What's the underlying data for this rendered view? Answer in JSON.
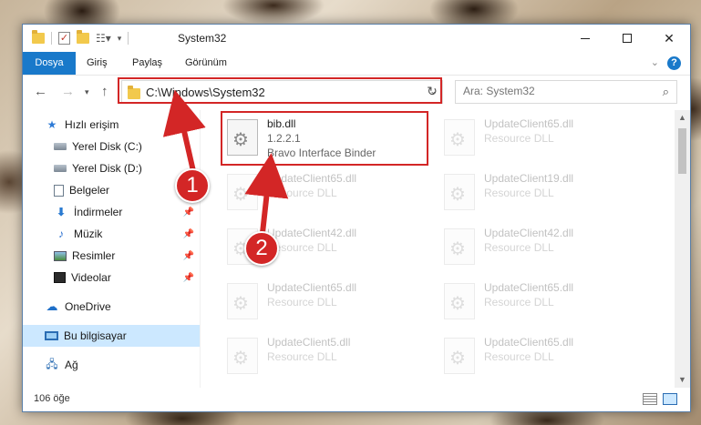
{
  "window": {
    "title": "System32",
    "ribbon_tabs": [
      "Dosya",
      "Giriş",
      "Paylaş",
      "Görünüm"
    ],
    "help_label": "?"
  },
  "navigation": {
    "address": "C:\\Windows\\System32",
    "search_placeholder": "Ara: System32"
  },
  "sidebar": {
    "items": [
      {
        "label": "Hızlı erişim",
        "icon": "star-icon"
      },
      {
        "label": "Yerel Disk (C:)",
        "icon": "drive-icon"
      },
      {
        "label": "Yerel Disk (D:)",
        "icon": "drive-icon"
      },
      {
        "label": "Belgeler",
        "icon": "documents-icon"
      },
      {
        "label": "İndirmeler",
        "icon": "downloads-icon"
      },
      {
        "label": "Müzik",
        "icon": "music-icon"
      },
      {
        "label": "Resimler",
        "icon": "pictures-icon"
      },
      {
        "label": "Videolar",
        "icon": "videos-icon"
      },
      {
        "label": "OneDrive",
        "icon": "cloud-icon"
      },
      {
        "label": "Bu bilgisayar",
        "icon": "computer-icon",
        "selected": true
      },
      {
        "label": "Ağ",
        "icon": "network-icon"
      }
    ]
  },
  "files": {
    "left_column": [
      {
        "name": "bib.dll",
        "version": "1.2.2.1",
        "description": "Bravo Interface Binder"
      },
      {
        "name": "UpdateClient65.dll",
        "type": "Resource DLL"
      },
      {
        "name": "UpdateClient42.dll",
        "type": "Resource DLL"
      },
      {
        "name": "UpdateClient65.dll",
        "type": "Resource DLL"
      },
      {
        "name": "UpdateClient5.dll",
        "type": "Resource DLL"
      }
    ],
    "right_column": [
      {
        "name": "UpdateClient65.dll",
        "type": "Resource DLL"
      },
      {
        "name": "UpdateClient19.dll",
        "type": "Resource DLL"
      },
      {
        "name": "UpdateClient42.dll",
        "type": "Resource DLL"
      },
      {
        "name": "UpdateClient65.dll",
        "type": "Resource DLL"
      },
      {
        "name": "UpdateClient65.dll",
        "type": "Resource DLL"
      }
    ]
  },
  "status": {
    "item_count": "106 öğe"
  },
  "callouts": [
    "1",
    "2"
  ],
  "colors": {
    "accent": "#1979ca",
    "highlight": "#d32626",
    "selection": "#cce8ff"
  }
}
